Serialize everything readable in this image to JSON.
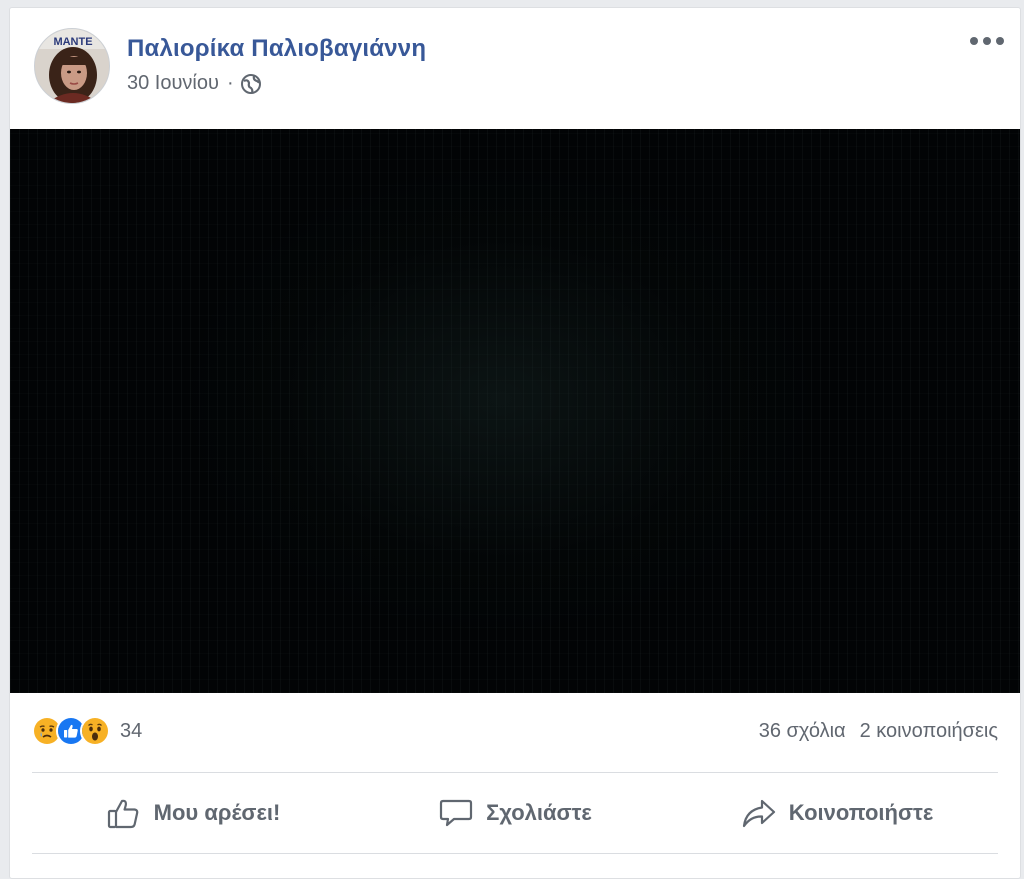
{
  "post": {
    "author": "Παλιορίκα Παλιοβαγιάννη",
    "date": "30 Ιουνίου",
    "separator": "·",
    "privacy_icon": "globe-icon",
    "avatar_text": "MANTE"
  },
  "stats": {
    "reactions": [
      "sad",
      "like",
      "wow"
    ],
    "reaction_count": "34",
    "comments": "36 σχόλια",
    "shares": "2 κοινοποιήσεις"
  },
  "actions": {
    "like_label": "Μου αρέσει!",
    "comment_label": "Σχολιάστε",
    "share_label": "Κοινοποιήστε"
  },
  "colors": {
    "author": "#385898",
    "like_blue": "#1877f2",
    "reaction_yellow": "#f7b125",
    "muted_text": "#616770"
  }
}
